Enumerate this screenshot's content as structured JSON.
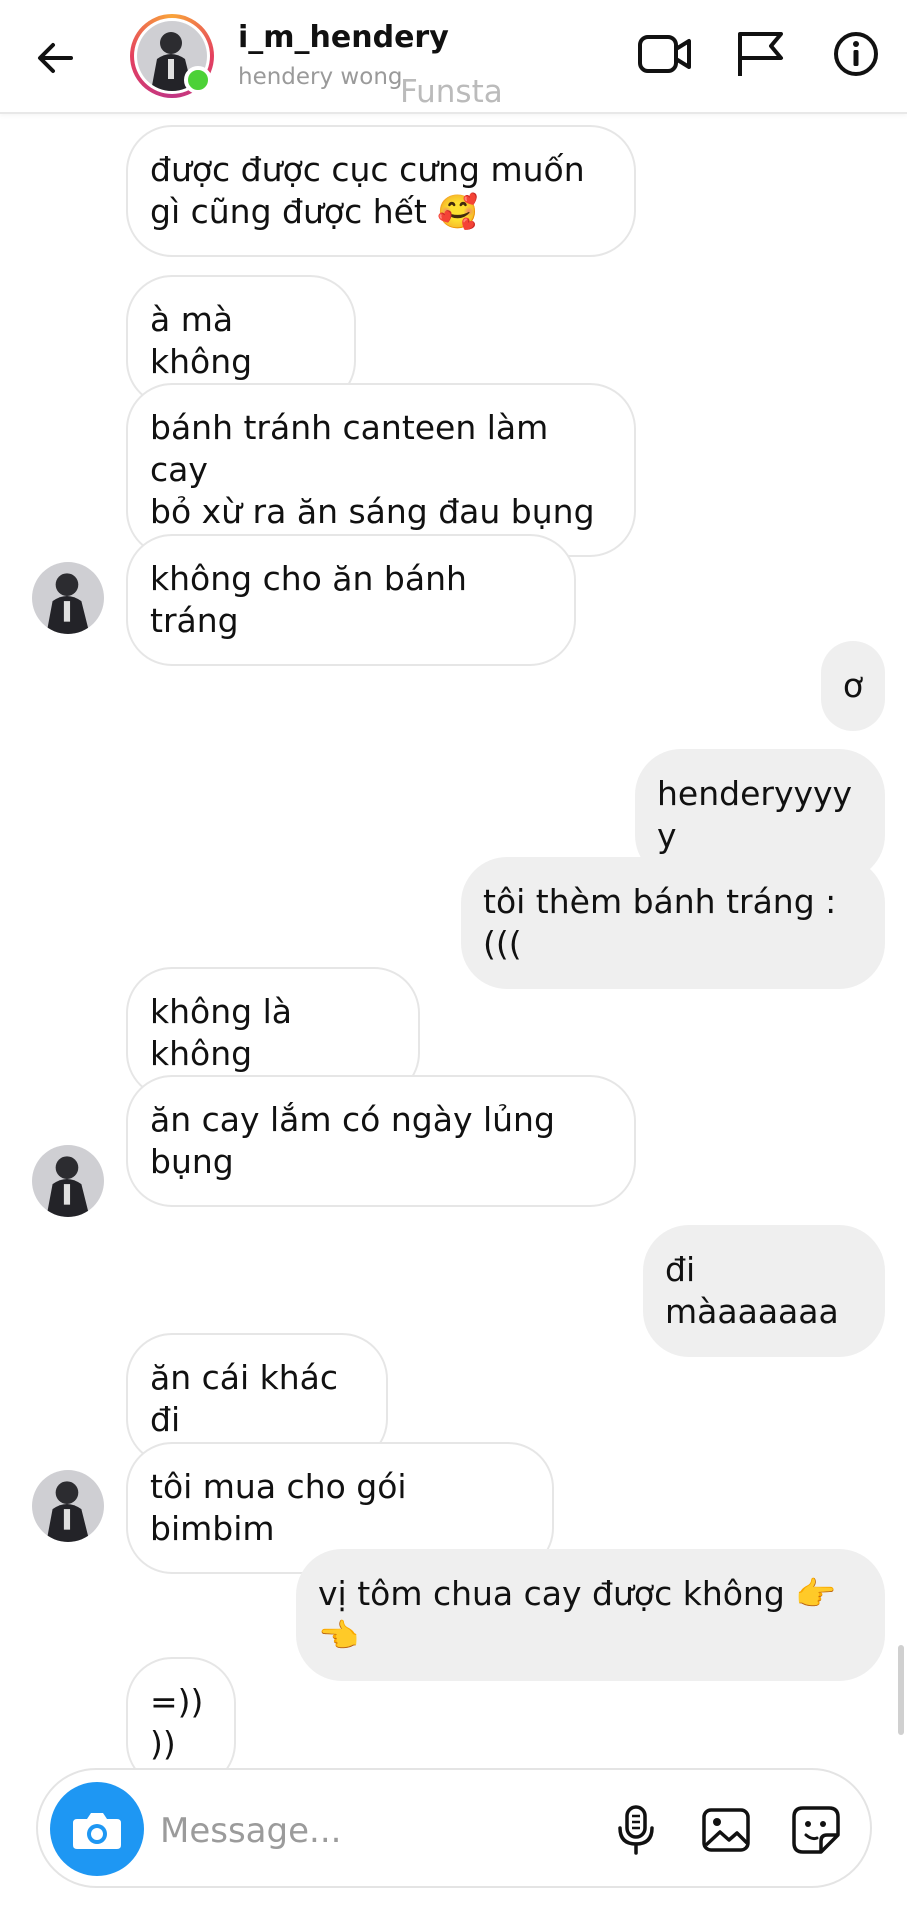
{
  "header": {
    "username": "i_m_hendery",
    "full_name": "hendery wong",
    "watermark": "Funsta",
    "online": true,
    "icons": [
      "back-arrow-icon",
      "video-call-icon",
      "flag-icon",
      "info-icon"
    ]
  },
  "messages": [
    {
      "id": "m1",
      "direction": "incoming",
      "text": "được được cục cưng muốn\ngì cũng được hết 🥰"
    },
    {
      "id": "m2",
      "direction": "incoming",
      "text": "à mà không"
    },
    {
      "id": "m3",
      "direction": "incoming",
      "text": "bánh tránh canteen làm cay\nbỏ xừ ra ăn sáng đau bụng"
    },
    {
      "id": "m4",
      "direction": "incoming",
      "text": "không cho ăn bánh tráng",
      "avatar": true
    },
    {
      "id": "m5",
      "direction": "outgoing",
      "text": "ơ"
    },
    {
      "id": "m6",
      "direction": "outgoing",
      "text": "henderyyyyy"
    },
    {
      "id": "m7",
      "direction": "outgoing",
      "text": "tôi thèm bánh tráng :((("
    },
    {
      "id": "m8",
      "direction": "incoming",
      "text": "không là không"
    },
    {
      "id": "m9",
      "direction": "incoming",
      "text": "ăn cay lắm có ngày lủng\nbụng",
      "avatar": true
    },
    {
      "id": "m10",
      "direction": "outgoing",
      "text": "đi màaaaaaa"
    },
    {
      "id": "m11",
      "direction": "incoming",
      "text": "ăn cái khác đi"
    },
    {
      "id": "m12",
      "direction": "incoming",
      "text": "tôi mua cho gói bimbim",
      "avatar": true
    },
    {
      "id": "m13",
      "direction": "outgoing",
      "text": "vị tôm chua cay được không 👉👈"
    },
    {
      "id": "m14",
      "direction": "incoming",
      "text": "=))))"
    }
  ],
  "composer": {
    "placeholder": "Message...",
    "icons": [
      "camera-icon",
      "microphone-icon",
      "gallery-icon",
      "sticker-icon"
    ]
  },
  "colors": {
    "accent_blue": "#1e97f3",
    "online_green": "#4cd137",
    "outgoing_bubble": "#efefef",
    "incoming_border": "#e6e6e6"
  }
}
